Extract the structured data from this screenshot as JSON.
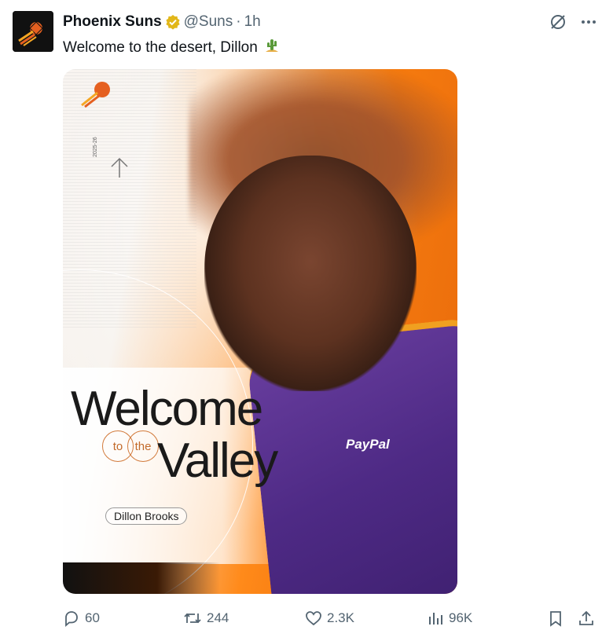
{
  "tweet": {
    "author": {
      "name": "Phoenix Suns",
      "handle": "@Suns",
      "separator": "·",
      "time": "1h",
      "verified_color": "#e2b719"
    },
    "text": "Welcome to the desert, Dillon",
    "emoji_icon": "cactus-icon",
    "media": {
      "headline_1": "Welcome",
      "connector_1": "to",
      "connector_2": "the",
      "headline_2": "Valley",
      "player_name": "Dillon Brooks",
      "sponsor": "PayPal",
      "season": "2025-26"
    },
    "actions": {
      "replies": "60",
      "reposts": "244",
      "likes": "2.3K",
      "views": "96K"
    }
  },
  "colors": {
    "accent_orange": "#f57a0f",
    "jersey_purple": "#4e2a85",
    "muted_text": "#536471"
  }
}
